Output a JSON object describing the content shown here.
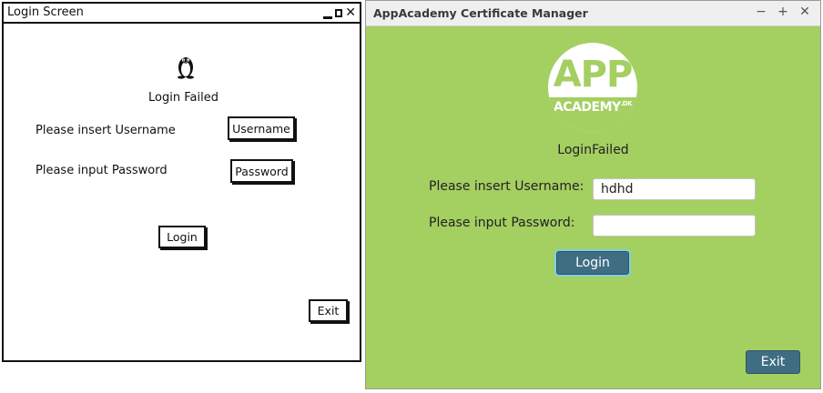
{
  "mockup": {
    "title": "Login Screen",
    "status": "Login Failed",
    "username_label": "Please insert Username",
    "password_label": "Please input Password",
    "username_button": "Username",
    "password_button": "Password",
    "login_button": "Login",
    "exit_button": "Exit"
  },
  "app": {
    "title": "AppAcademy Certificate Manager",
    "window_controls": {
      "minimize": "−",
      "maximize": "+",
      "close": "✕"
    },
    "logo": {
      "top_text": "APP",
      "bottom_text": "ACADEMY",
      "suffix": ".DK"
    },
    "status": "LoginFailed",
    "username_label": "Please insert Username:",
    "password_label": "Please input Password:",
    "username_value": "hdhd",
    "password_value": "",
    "login_button": "Login",
    "exit_button": "Exit",
    "colors": {
      "background": "#a4cf61",
      "button": "#3f6e82",
      "focus_ring": "#7fd0e6"
    }
  }
}
